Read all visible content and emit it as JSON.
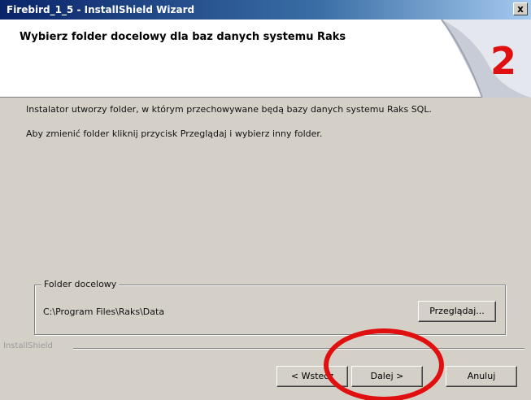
{
  "window": {
    "title": "Firebird_1_5 - InstallShield Wizard",
    "close_label": "x"
  },
  "header": {
    "title": "Wybierz folder docelowy dla baz danych systemu Raks",
    "step_number": "2"
  },
  "body": {
    "text_line1": "Instalator utworzy folder, w którym przechowywane będą bazy danych systemu Raks SQL.",
    "text_line2": "Aby zmienić folder kliknij przycisk Przeglądaj i wybierz inny folder."
  },
  "folder_group": {
    "label": "Folder docelowy",
    "path": "C:\\Program Files\\Raks\\Data",
    "browse_label": "Przeglądaj..."
  },
  "footer": {
    "brand": "InstallShield",
    "back_label": "< Wstecz",
    "next_label": "Dalej >",
    "cancel_label": "Anuluj"
  },
  "colors": {
    "annotation": "#e01010",
    "title_bar": "#0a246a"
  }
}
